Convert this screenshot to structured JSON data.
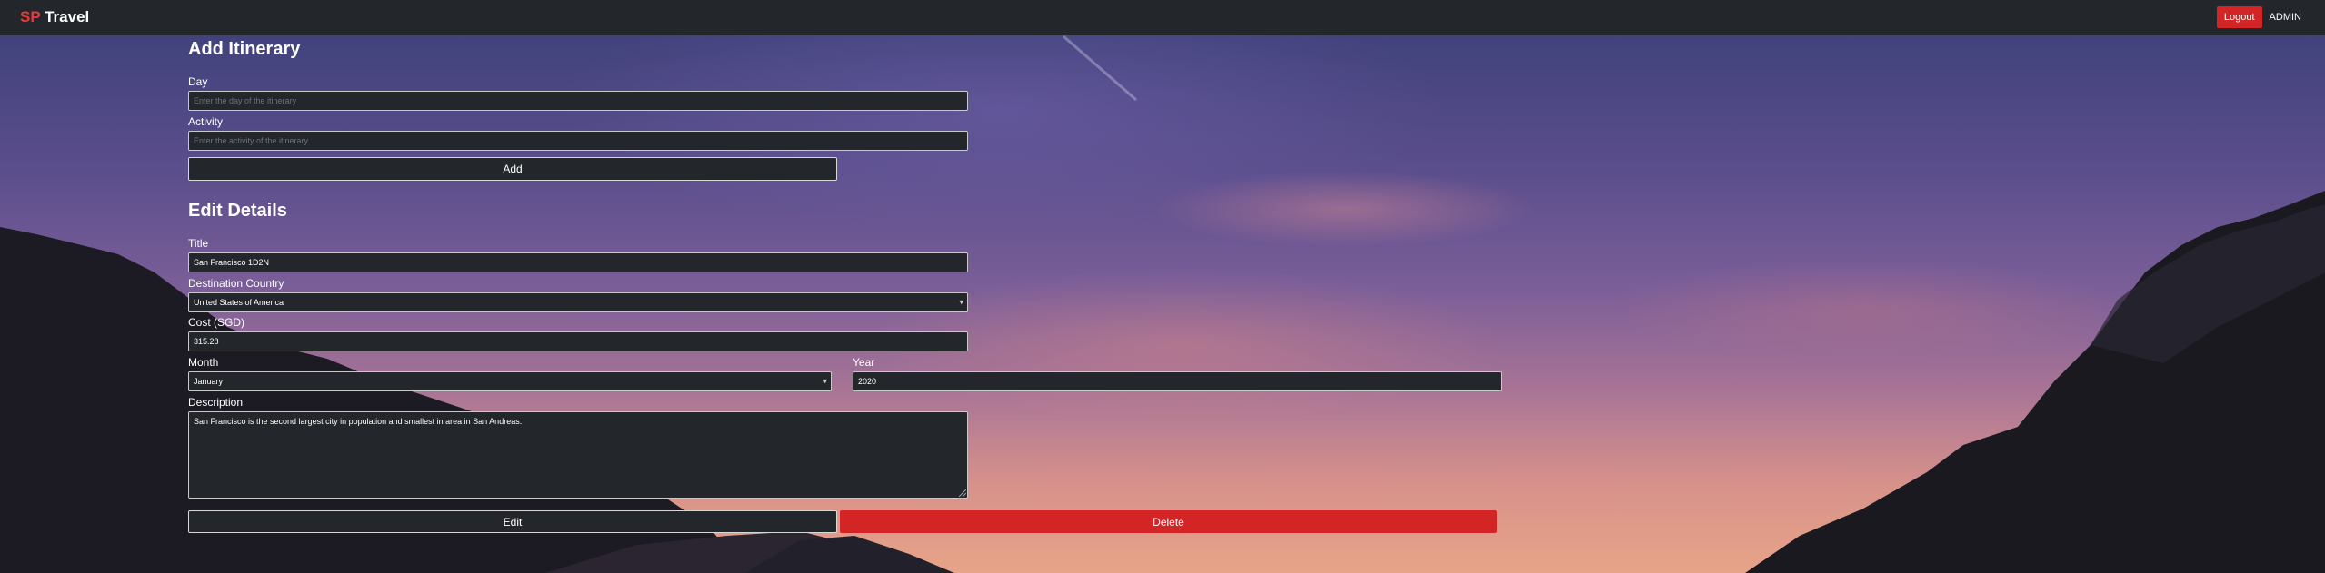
{
  "navbar": {
    "brand_sp": "SP",
    "brand_travel": "Travel",
    "logout_label": "Logout",
    "user_label": "ADMIN"
  },
  "add_itinerary": {
    "heading": "Add Itinerary",
    "day_label": "Day",
    "day_placeholder": "Enter the day of the itinerary",
    "day_value": "",
    "activity_label": "Activity",
    "activity_placeholder": "Enter the activity of the itinerary",
    "activity_value": "",
    "add_button": "Add"
  },
  "edit_details": {
    "heading": "Edit Details",
    "title_label": "Title",
    "title_value": "San Francisco 1D2N",
    "country_label": "Destination Country",
    "country_value": "United States of America",
    "cost_label": "Cost (SGD)",
    "cost_value": "315.28",
    "month_label": "Month",
    "month_value": "January",
    "year_label": "Year",
    "year_value": "2020",
    "description_label": "Description",
    "description_value": "San Francisco is the second largest city in population and smallest in area in San Andreas.",
    "edit_button": "Edit",
    "delete_button": "Delete"
  },
  "colors": {
    "navbar_bg": "#23272b",
    "brand_accent": "#e63a3a",
    "danger": "#d32525",
    "input_bg": "#23272b"
  }
}
